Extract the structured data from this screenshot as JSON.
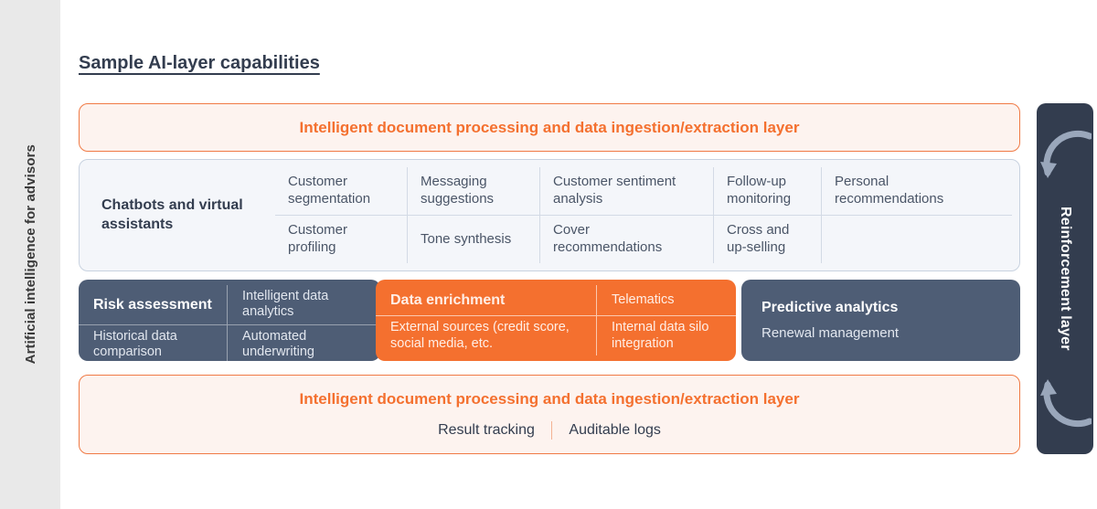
{
  "left_band": {
    "label": "Artificial intelligence for advisors"
  },
  "page_title": "Sample AI-layer capabilities",
  "top_band": {
    "title": "Intelligent document processing and data ingestion/extraction layer"
  },
  "chatbots_panel": {
    "title": "Chatbots and virtual assistants",
    "capabilities": [
      [
        "Customer segmentation",
        "Messaging suggestions",
        "Customer sentiment analysis",
        "Follow-up monitoring",
        "Personal recommendations"
      ],
      [
        "Customer profiling",
        "Tone synthesis",
        "Cover recommendations",
        "Cross and up-selling",
        ""
      ]
    ]
  },
  "cards": {
    "risk": {
      "head": "Risk assessment",
      "top_right": "Intelligent data analytics",
      "bottom_left": "Historical data comparison",
      "bottom_right": "Automated underwriting"
    },
    "data": {
      "head": "Data enrichment",
      "top_right": "Telematics",
      "bottom_left": "External sources (credit score, social media, etc.",
      "bottom_right": "Internal data silo integration"
    },
    "predictive": {
      "head": "Predictive analytics",
      "sub": "Renewal management"
    }
  },
  "bottom_band": {
    "title": "Intelligent document processing and data ingestion/extraction layer",
    "sub_left": "Result tracking",
    "sub_right": "Auditable logs"
  },
  "right_panel": {
    "label": "Reinforcement layer"
  },
  "colors": {
    "orange": "#f4702f",
    "orange_bg": "#fdf3ef",
    "slate": "#4e5d75",
    "navy": "#333d4f",
    "light_panel": "#f4f6fa",
    "band_grey": "#e9e9e9"
  }
}
